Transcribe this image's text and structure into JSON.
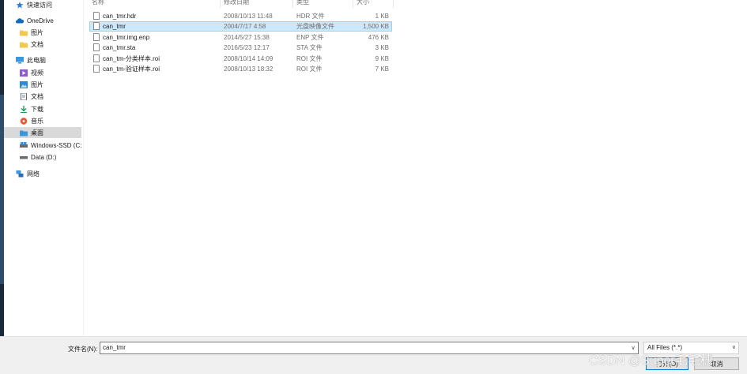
{
  "nav": {
    "items": [
      {
        "label": "快速访问",
        "icon": "star-icon"
      },
      {
        "label": "OneDrive",
        "icon": "cloud-icon"
      },
      {
        "label": "图片",
        "icon": "folder-icon"
      },
      {
        "label": "文档",
        "icon": "folder-icon"
      },
      {
        "label": "此电脑",
        "icon": "computer-icon"
      },
      {
        "label": "视频",
        "icon": "video-icon"
      },
      {
        "label": "图片",
        "icon": "picture-icon"
      },
      {
        "label": "文档",
        "icon": "document-icon"
      },
      {
        "label": "下载",
        "icon": "download-arrow-icon"
      },
      {
        "label": "音乐",
        "icon": "music-icon"
      },
      {
        "label": "桌面",
        "icon": "desktop-folder-icon"
      },
      {
        "label": "Windows-SSD (C:",
        "icon": "drive-icon"
      },
      {
        "label": "Data (D:)",
        "icon": "drive-icon"
      },
      {
        "label": "网络",
        "icon": "network-icon"
      }
    ],
    "selected": "桌面"
  },
  "columns": {
    "name": "名称",
    "modified": "修改日期",
    "type": "类型",
    "size": "大小"
  },
  "files": [
    {
      "name": "can_tmr.hdr",
      "modified": "2008/10/13 11:48",
      "type": "HDR 文件",
      "size": "1 KB"
    },
    {
      "name": "can_tmr",
      "modified": "2004/7/17 4:58",
      "type": "光盘映像文件",
      "size": "1,500 KB"
    },
    {
      "name": "can_tmr.img.enp",
      "modified": "2014/5/27 15:38",
      "type": "ENP 文件",
      "size": "476 KB"
    },
    {
      "name": "can_tmr.sta",
      "modified": "2016/5/23 12:17",
      "type": "STA 文件",
      "size": "3 KB"
    },
    {
      "name": "can_tm-分类样本.roi",
      "modified": "2008/10/14 14:09",
      "type": "ROI 文件",
      "size": "9 KB"
    },
    {
      "name": "can_tm-验证样本.roi",
      "modified": "2008/10/13 18:32",
      "type": "ROI 文件",
      "size": "7 KB"
    }
  ],
  "selected_file": "can_tmr",
  "bottom": {
    "filename_label": "文件名(N):",
    "filename_value": "can_tmr",
    "filter_value": "All Files (*.*)",
    "open_label": "打开(O)",
    "cancel_label": "取消",
    "dropdown_glyph": "∨"
  },
  "watermark": "CSDN @Super毛毛穗",
  "colors": {
    "selection_bg": "#cce8ff",
    "selection_border": "#99d1ff",
    "nav_selected": "#d9d9d9",
    "accent": "#0078d7"
  }
}
